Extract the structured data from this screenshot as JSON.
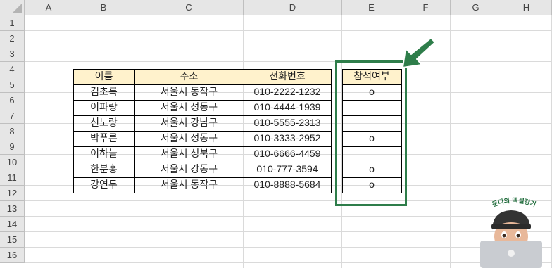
{
  "columns": [
    "A",
    "B",
    "C",
    "D",
    "E",
    "F",
    "G",
    "H"
  ],
  "rows": [
    "1",
    "2",
    "3",
    "4",
    "5",
    "6",
    "7",
    "8",
    "9",
    "10",
    "11",
    "12",
    "13",
    "14",
    "15",
    "16"
  ],
  "table": {
    "headers": {
      "name": "이름",
      "address": "주소",
      "phone": "전화번호"
    },
    "records": [
      {
        "name": "김초록",
        "address": "서울시 동작구",
        "phone": "010-2222-1232"
      },
      {
        "name": "이파랑",
        "address": "서울시 성동구",
        "phone": "010-4444-1939"
      },
      {
        "name": "신노랑",
        "address": "서울시 강남구",
        "phone": "010-5555-2313"
      },
      {
        "name": "박푸른",
        "address": "서울시 성동구",
        "phone": "010-3333-2952"
      },
      {
        "name": "이하늘",
        "address": "서울시 성북구",
        "phone": "010-6666-4459"
      },
      {
        "name": "한분홍",
        "address": "서울시 강동구",
        "phone": "010-777-3594"
      },
      {
        "name": "강연두",
        "address": "서울시 동작구",
        "phone": "010-8888-5684"
      }
    ]
  },
  "attendance": {
    "header": "참석여부",
    "values": [
      "o",
      "",
      "",
      "o",
      "",
      "o",
      "o"
    ]
  },
  "annotation": {
    "frame_color": "#2e7d4a",
    "arrow_color": "#2e7d4a",
    "arrow_icon": "arrow-down-left-icon"
  },
  "watermark": {
    "text": "문디의 엑셀강기"
  },
  "colors": {
    "header_fill": "#fff2cc",
    "grid": "#dadada",
    "header_bg": "#e6e6e6"
  }
}
